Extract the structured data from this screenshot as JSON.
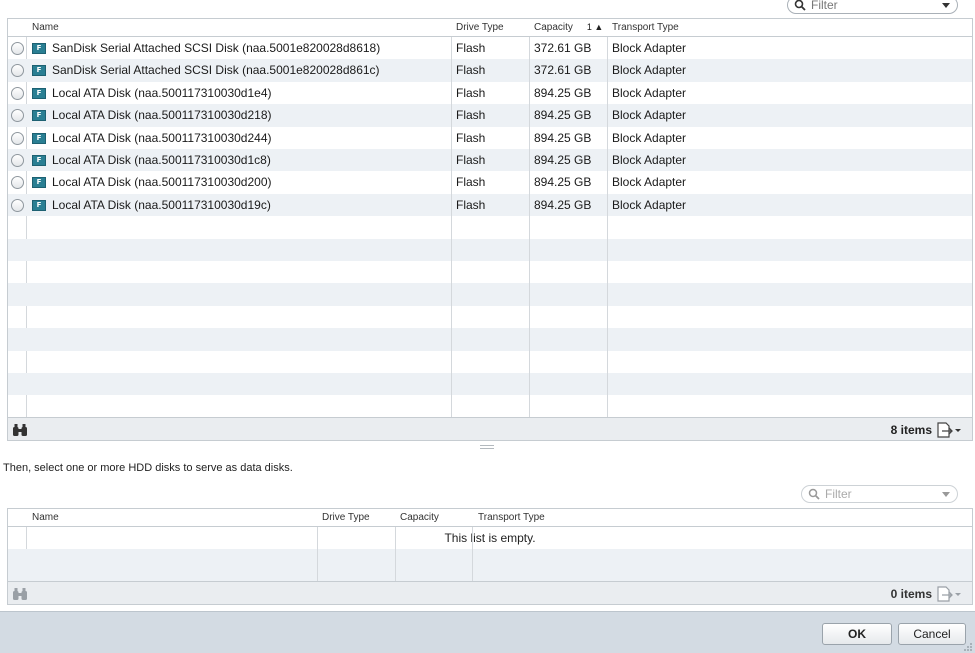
{
  "top_filter": {
    "placeholder": "Filter",
    "icon": "search-icon"
  },
  "flash_grid": {
    "columns": [
      {
        "label": "Name"
      },
      {
        "label": "Drive Type"
      },
      {
        "label": "Capacity",
        "sort": "1 ▲"
      },
      {
        "label": "Transport Type"
      }
    ],
    "rows": [
      {
        "badge": "F",
        "name": "SanDisk Serial Attached SCSI Disk (naa.5001e820028d8618)",
        "drive_type": "Flash",
        "capacity": "372.61 GB",
        "transport": "Block Adapter"
      },
      {
        "badge": "F",
        "name": "SanDisk Serial Attached SCSI Disk (naa.5001e820028d861c)",
        "drive_type": "Flash",
        "capacity": "372.61 GB",
        "transport": "Block Adapter"
      },
      {
        "badge": "F",
        "name": "Local ATA Disk (naa.500117310030d1e4)",
        "drive_type": "Flash",
        "capacity": "894.25 GB",
        "transport": "Block Adapter"
      },
      {
        "badge": "F",
        "name": "Local ATA Disk (naa.500117310030d218)",
        "drive_type": "Flash",
        "capacity": "894.25 GB",
        "transport": "Block Adapter"
      },
      {
        "badge": "F",
        "name": "Local ATA Disk (naa.500117310030d244)",
        "drive_type": "Flash",
        "capacity": "894.25 GB",
        "transport": "Block Adapter"
      },
      {
        "badge": "F",
        "name": "Local ATA Disk (naa.500117310030d1c8)",
        "drive_type": "Flash",
        "capacity": "894.25 GB",
        "transport": "Block Adapter"
      },
      {
        "badge": "F",
        "name": "Local ATA Disk (naa.500117310030d200)",
        "drive_type": "Flash",
        "capacity": "894.25 GB",
        "transport": "Block Adapter"
      },
      {
        "badge": "F",
        "name": "Local ATA Disk (naa.500117310030d19c)",
        "drive_type": "Flash",
        "capacity": "894.25 GB",
        "transport": "Block Adapter"
      }
    ],
    "item_count": "8 items"
  },
  "instruction": "Then, select one or more HDD disks to serve as data disks.",
  "hdd_filter": {
    "placeholder": "Filter",
    "icon": "search-icon"
  },
  "hdd_grid": {
    "columns": [
      {
        "label": "Name"
      },
      {
        "label": "Drive Type"
      },
      {
        "label": "Capacity"
      },
      {
        "label": "Transport Type"
      }
    ],
    "empty_message": "This list is empty.",
    "item_count": "0 items"
  },
  "buttons": {
    "ok": "OK",
    "cancel": "Cancel"
  },
  "colors": {
    "alt_row": "#edf1f5",
    "footer_bar": "#d3dbe3",
    "flash_badge": "#2a7f93"
  }
}
